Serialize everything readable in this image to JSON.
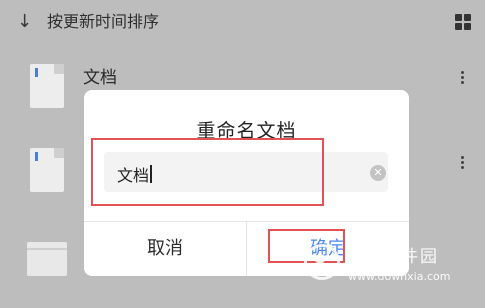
{
  "sortbar": {
    "arrow": "↓",
    "label": "按更新时间排序",
    "view_toggle_icon": "grid-icon"
  },
  "list": [
    {
      "title": "文档",
      "subtitle": "",
      "icon": "doc-file-icon"
    },
    {
      "title": "",
      "subtitle": "",
      "icon": "doc-file-icon"
    },
    {
      "title": "",
      "subtitle": "",
      "icon": "folder-icon"
    }
  ],
  "dialog": {
    "title": "重命名文档",
    "field_value": "文档",
    "cancel_label": "取消",
    "ok_label": "确定"
  },
  "colors": {
    "accent": "#4a86f0",
    "highlight": "#e25252",
    "overlay": "#bdbdbd"
  },
  "watermark": {
    "name": "当下软件园",
    "url": "www.downxia.com"
  }
}
